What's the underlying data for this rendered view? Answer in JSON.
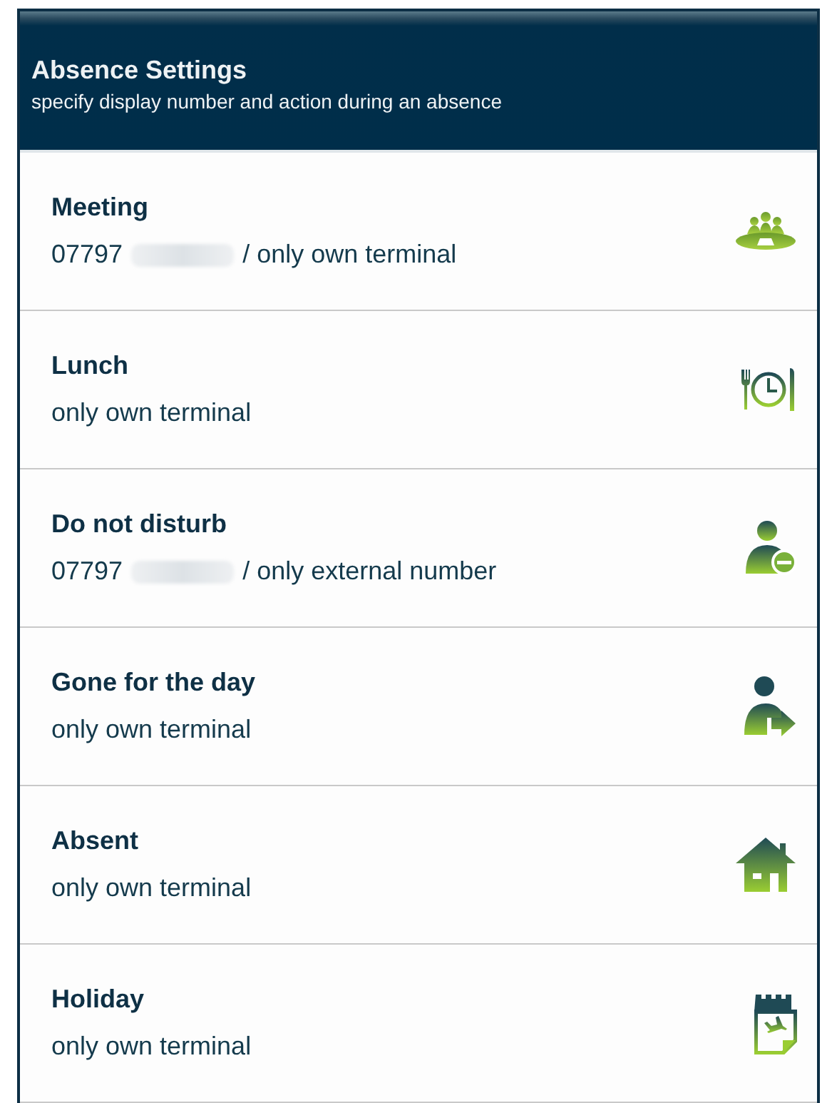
{
  "header": {
    "title": "Absence Settings",
    "subtitle": "specify display number and action during an absence"
  },
  "items": [
    {
      "title": "Meeting",
      "number": "07797",
      "redacted": true,
      "detail": "/ only own terminal",
      "kind": "meeting"
    },
    {
      "title": "Lunch",
      "detail": "only own terminal",
      "kind": "lunch"
    },
    {
      "title": "Do not disturb",
      "number": "07797",
      "redacted": true,
      "detail": "/ only external number",
      "kind": "dnd"
    },
    {
      "title": "Gone for the day",
      "detail": "only own terminal",
      "kind": "gone"
    },
    {
      "title": "Absent",
      "detail": "only own terminal",
      "kind": "absent"
    },
    {
      "title": "Holiday",
      "detail": "only own terminal",
      "kind": "holiday"
    }
  ]
}
